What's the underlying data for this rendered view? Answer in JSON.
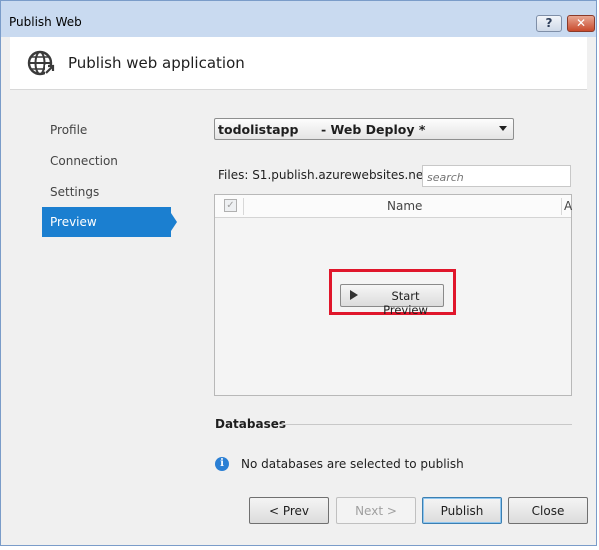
{
  "window": {
    "title": "Publish Web",
    "help_label": "?",
    "close_label": "✕"
  },
  "header": {
    "title": "Publish web application",
    "icon": "globe-publish-icon"
  },
  "sidebar": {
    "items": [
      {
        "label": "Profile",
        "active": false
      },
      {
        "label": "Connection",
        "active": false
      },
      {
        "label": "Settings",
        "active": false
      },
      {
        "label": "Preview",
        "active": true
      }
    ]
  },
  "profile": {
    "name": "todolistapp",
    "suffix": " - Web Deploy *"
  },
  "files": {
    "label": "Files: S1.publish.azurewebsites.net...",
    "search_placeholder": "search",
    "columns": [
      "Name",
      "A"
    ],
    "start_preview_label": "Start Preview"
  },
  "databases": {
    "title": "Databases",
    "message": "No databases are selected to publish",
    "icon": "info-icon"
  },
  "buttons": {
    "prev": "< Prev",
    "next": "Next >",
    "publish": "Publish",
    "close": "Close"
  },
  "colors": {
    "accent": "#1b7fd0",
    "highlight": "#e0162b"
  }
}
